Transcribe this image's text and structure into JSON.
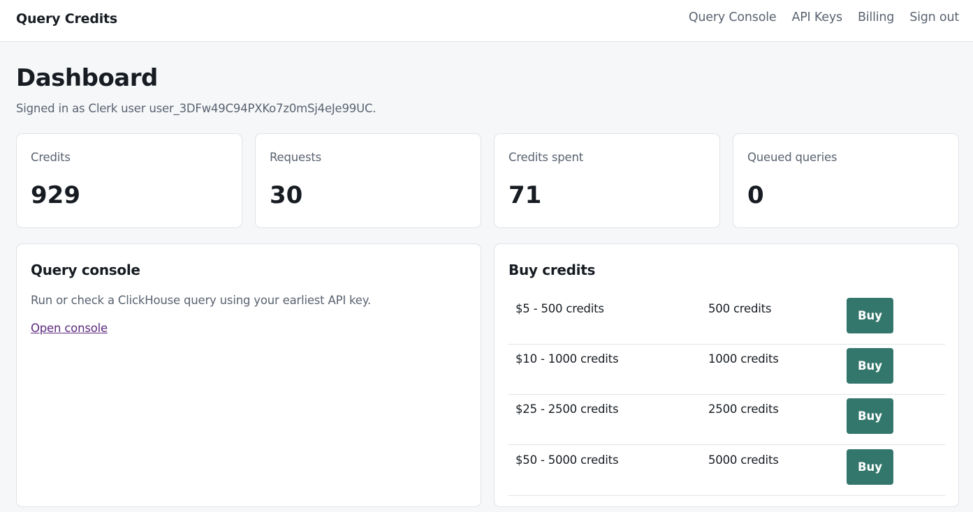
{
  "header": {
    "brand": "Query Credits",
    "nav": [
      "Query Console",
      "API Keys",
      "Billing",
      "Sign out"
    ]
  },
  "page": {
    "title": "Dashboard",
    "subtitle": "Signed in as Clerk user user_3DFw49C94PXKo7z0mSj4eJe99UC."
  },
  "stats": [
    {
      "label": "Credits",
      "value": "929"
    },
    {
      "label": "Requests",
      "value": "30"
    },
    {
      "label": "Credits spent",
      "value": "71"
    },
    {
      "label": "Queued queries",
      "value": "0"
    }
  ],
  "console": {
    "title": "Query console",
    "description": "Run or check a ClickHouse query using your earliest API key.",
    "link": "Open console"
  },
  "buy": {
    "title": "Buy credits",
    "button_label": "Buy",
    "packages": [
      {
        "name": "$5 - 500 credits",
        "credits": "500 credits"
      },
      {
        "name": "$10 - 1000 credits",
        "credits": "1000 credits"
      },
      {
        "name": "$25 - 2500 credits",
        "credits": "2500 credits"
      },
      {
        "name": "$50 - 5000 credits",
        "credits": "5000 credits"
      }
    ]
  },
  "colors": {
    "accent": "#33766b",
    "link": "#5d2a7e",
    "background": "#f6f7f9"
  }
}
